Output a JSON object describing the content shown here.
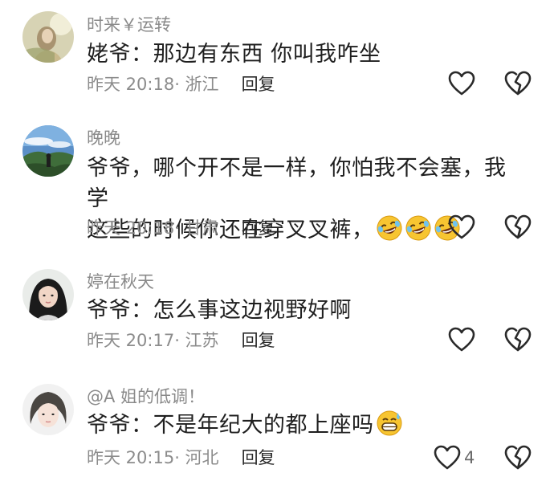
{
  "comments": [
    {
      "username": "时来￥运转",
      "text": "姥爷：那边有东西 你叫我咋坐",
      "time": "昨天 20:18",
      "location": "· 浙江",
      "reply_label": "回复",
      "like_count": ""
    },
    {
      "username": "晚晚",
      "text_line1": "爷爷，哪个开不是一样，你怕我不会塞，我学",
      "text_line2": "这些的时候你还在穿叉叉裤，",
      "time": "昨天 20:18",
      "location": "· 甘肃",
      "reply_label": "回复",
      "like_count": ""
    },
    {
      "username": "婷在秋天",
      "text": "爷爷：怎么事这边视野好啊",
      "time": "昨天 20:17",
      "location": "· 江苏",
      "reply_label": "回复",
      "like_count": ""
    },
    {
      "username": "@A 姐的低调！",
      "text": "爷爷：不是年纪大的都上座吗",
      "time": "昨天 20:15",
      "location": "· 河北",
      "reply_label": "回复",
      "like_count": "4"
    }
  ],
  "icons": {
    "like": "heart-outline-icon",
    "dislike": "broken-heart-icon",
    "emoji_laugh": "rofl-emoji",
    "emoji_sweat": "grin-sweat-emoji"
  },
  "colors": {
    "meta": "#8c8c8c",
    "text": "#1f1f1f",
    "icon": "#2a2a2a"
  }
}
